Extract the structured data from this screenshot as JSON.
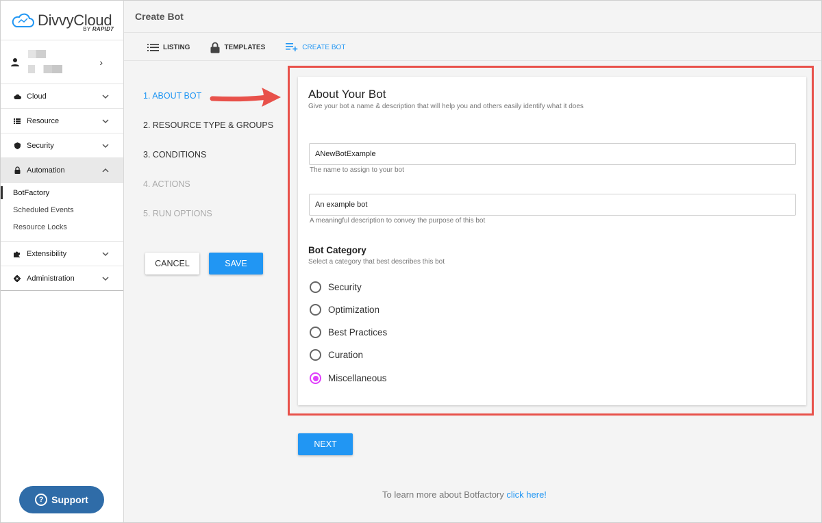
{
  "brand": {
    "name": "DivvyCloud",
    "by": "BY",
    "by_company": "RAPID7",
    "color": "#2196f3"
  },
  "sidebar": {
    "nav": [
      {
        "label": "Cloud",
        "icon": "cloud-icon"
      },
      {
        "label": "Resource",
        "icon": "list-icon"
      },
      {
        "label": "Security",
        "icon": "shield-icon"
      },
      {
        "label": "Automation",
        "icon": "lock-icon",
        "expanded": true
      }
    ],
    "automation_items": [
      {
        "label": "BotFactory",
        "current": true
      },
      {
        "label": "Scheduled Events"
      },
      {
        "label": "Resource Locks"
      }
    ],
    "nav_bottom": [
      {
        "label": "Extensibility",
        "icon": "puzzle-icon"
      },
      {
        "label": "Administration",
        "icon": "gear-icon"
      }
    ],
    "support_label": "Support"
  },
  "header": {
    "title": "Create Bot"
  },
  "tabs": [
    {
      "label": "LISTING",
      "icon": "list-icon"
    },
    {
      "label": "TEMPLATES",
      "icon": "lock-icon"
    },
    {
      "label": "CREATE BOT",
      "icon": "playlist-add-icon",
      "active": true
    }
  ],
  "steps": [
    {
      "label": "1. ABOUT BOT",
      "state": "active"
    },
    {
      "label": "2. RESOURCE TYPE & GROUPS",
      "state": "enabled"
    },
    {
      "label": "3. CONDITIONS",
      "state": "enabled"
    },
    {
      "label": "4. ACTIONS",
      "state": "disabled"
    },
    {
      "label": "5. RUN OPTIONS",
      "state": "disabled"
    }
  ],
  "actions": {
    "cancel_label": "CANCEL",
    "save_label": "SAVE",
    "next_label": "NEXT"
  },
  "form": {
    "title": "About Your Bot",
    "subtitle": "Give your bot a name & description that will help you and others easily identify what it does",
    "name_value": "ANewBotExample",
    "name_hint": "The name to assign to your bot",
    "description_value": "An example bot",
    "description_hint": "A meaningful description to convey the purpose of this bot",
    "category_title": "Bot Category",
    "category_subtitle": "Select a category that best describes this bot",
    "categories": [
      "Security",
      "Optimization",
      "Best Practices",
      "Curation",
      "Miscellaneous"
    ],
    "selected_category": "Miscellaneous",
    "radio_accent": "#e040fb"
  },
  "footer": {
    "learn_text": "To learn more about Botfactory",
    "learn_link": "click here!"
  },
  "annotation": {
    "highlight_color": "#e8514a"
  }
}
